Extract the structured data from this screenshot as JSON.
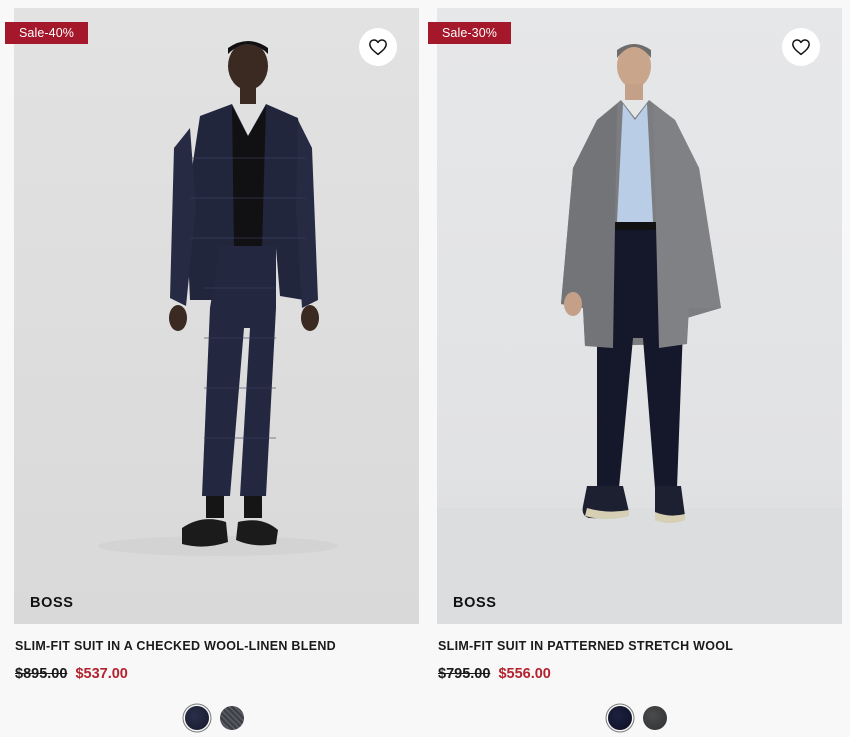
{
  "products": [
    {
      "badge": "Sale-40%",
      "brand": "BOSS",
      "title": "SLIM-FIT SUIT IN A CHECKED WOOL-LINEN BLEND",
      "price_original": "$895.00",
      "price_sale": "$537.00",
      "wishlist_icon": "heart-outline-icon",
      "swatches": [
        {
          "color": "#1c2036",
          "selected": true
        },
        {
          "color": "#4a4b52",
          "selected": false
        }
      ]
    },
    {
      "badge": "Sale-30%",
      "brand": "BOSS",
      "title": "SLIM-FIT SUIT IN PATTERNED STRETCH WOOL",
      "price_original": "$795.00",
      "price_sale": "$556.00",
      "wishlist_icon": "heart-outline-icon",
      "swatches": [
        {
          "color": "#14172e",
          "selected": true
        },
        {
          "color": "#3b3c3e",
          "selected": false
        }
      ]
    }
  ],
  "colors": {
    "sale_badge": "#a5172a",
    "sale_price": "#b3232f",
    "background": "#f8f8f8"
  }
}
